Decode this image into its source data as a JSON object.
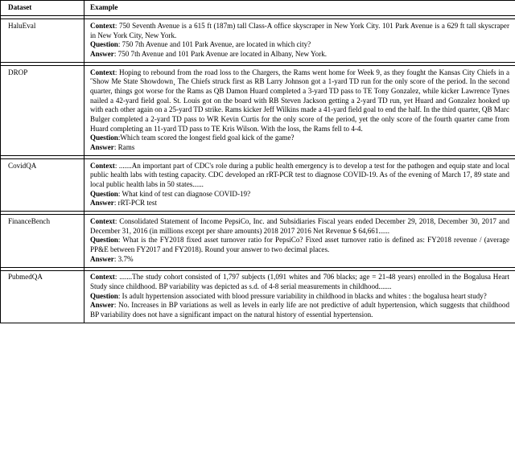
{
  "table": {
    "headers": {
      "dataset": "Dataset",
      "example": "Example"
    },
    "labels": {
      "context": "Context",
      "question": "Question",
      "answer": "Answer",
      "colon": ":"
    },
    "rows": [
      {
        "dataset": "HaluEval",
        "context": " 750 Seventh Avenue is a 615 ft (187m) tall Class-A office skyscraper in New York City. 101 Park Avenue is a 629 ft tall skyscraper in New York City, New York.",
        "question": " 750 7th Avenue and 101 Park Avenue, are located in which city?",
        "answer": " 750 7th Avenue and 101 Park Avenue are located in Albany, New York."
      },
      {
        "dataset": "DROP",
        "context": "  Hoping to rebound from the road loss to the Chargers, the Rams went home for Week 9, as they fought the Kansas City Chiefs in a ˝Show Me State Showdown¸ The Chiefs struck first as RB Larry Johnson got a 1-yard TD run for the only score of the period. In the second quarter, things got worse for the Rams as QB Damon Huard completed a 3-yard TD pass to TE Tony Gonzalez, while kicker Lawrence Tynes nailed a 42-yard field goal. St. Louis got on the board with RB Steven Jackson getting a 2-yard TD run, yet Huard and Gonzalez hooked up with each other again on a 25-yard TD strike. Rams kicker Jeff Wilkins made a 41-yard field goal to end the half.  In the third quarter, QB Marc Bulger completed a 2-yard TD pass to WR Kevin Curtis for the only score of the period, yet the only score of the fourth quarter came from Huard completing an 11-yard TD pass to TE Kris Wilson. With the loss, the Rams fell to 4-4.",
        "question": "Which team scored the longest field goal kick of the game?",
        "answer": " Rams"
      },
      {
        "dataset": "CovidQA",
        "context": "  .......An important part of CDC's role during a public health emergency is to develop a test for the pathogen and equip state and local public health labs with testing capacity. CDC developed an rRT-PCR test to diagnose COVID-19. As of the evening of March 17, 89 state and local public health labs in 50 states......",
        "question": " What kind of test can diagnose COVID-19?",
        "answer": " rRT-PCR test"
      },
      {
        "dataset": "FinanceBench",
        "context": " Consolidated Statement of Income PepsiCo, Inc. and Subsidiaries Fiscal years ended December 29, 2018, December 30, 2017 and December 31, 2016 (in millions except per share amounts) 2018 2017 2016 Net Revenue $ 64,661......",
        "question": "  What is the FY2018 fixed asset turnover ratio for PepsiCo?  Fixed asset turnover ratio is defined as: FY2018 revenue / (average PP&E between FY2017 and FY2018).  Round your answer to two decimal places.",
        "answer": " 3.7%"
      },
      {
        "dataset": "PubmedQA",
        "context": "  .......The study cohort consisted of 1,797 subjects (1,091 whites and 706 blacks; age = 21-48 years) enrolled in the Bogalusa Heart Study since childhood. BP variability was depicted as s.d. of 4-8 serial measurements in childhood.......",
        "question": " Is adult hypertension associated with blood pressure variability in childhood in blacks and whites : the bogalusa heart study?",
        "answer": "  No.  Increases in BP variations as well as levels in early life are not predictive of adult hypertension, which suggests that childhood BP variability does not have a significant impact on the natural history of essential hypertension."
      }
    ]
  }
}
